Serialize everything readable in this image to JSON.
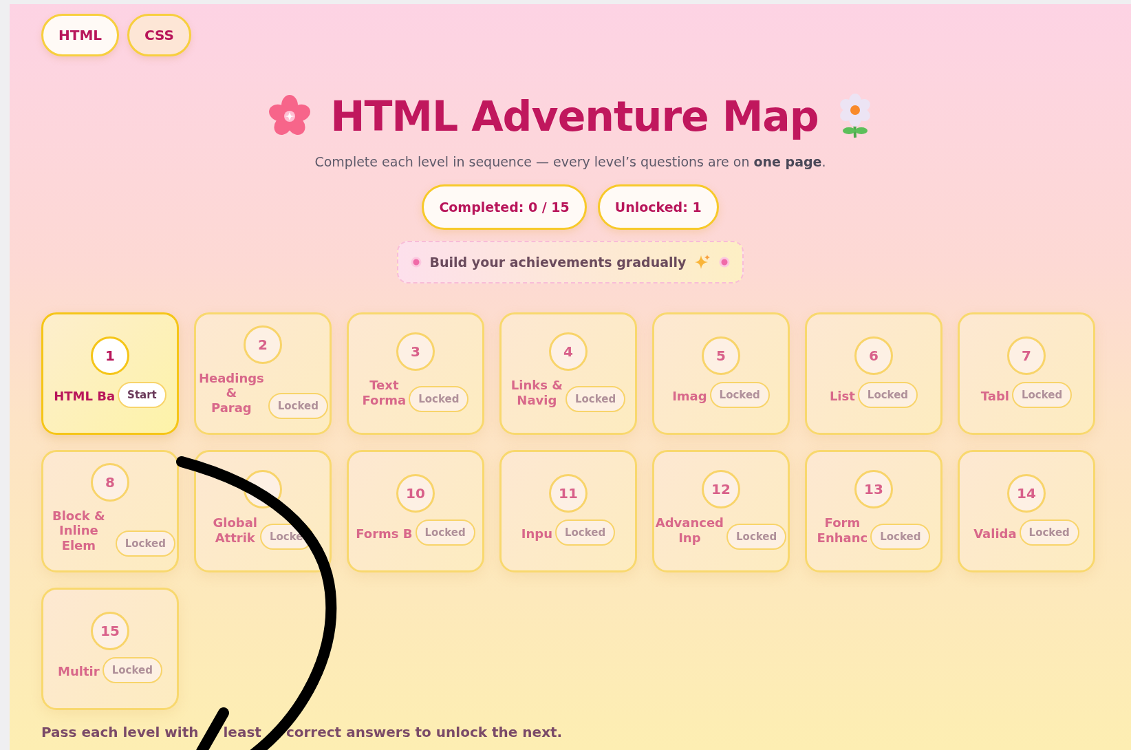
{
  "tabs": [
    {
      "label": "HTML",
      "selected": true
    },
    {
      "label": "CSS",
      "selected": false
    }
  ],
  "header": {
    "title": "HTML Adventure Map",
    "subtitle": "Complete each level in sequence — every level’s questions are on **one page**."
  },
  "stats": [
    "Completed: 0 / 15",
    "Unlocked: 1"
  ],
  "banner": "Build your achievements gradually",
  "levels": [
    {
      "number": "1",
      "title": "HTML Ba",
      "badge": "Start",
      "locked": false
    },
    {
      "number": "2",
      "title": "Headings &\nParag",
      "badge": "Locked",
      "locked": true
    },
    {
      "number": "3",
      "title": "Text\nForma",
      "badge": "Locked",
      "locked": true
    },
    {
      "number": "4",
      "title": "Links &\nNavig",
      "badge": "Locked",
      "locked": true
    },
    {
      "number": "5",
      "title": "Imag",
      "badge": "Locked",
      "locked": true
    },
    {
      "number": "6",
      "title": "List",
      "badge": "Locked",
      "locked": true
    },
    {
      "number": "7",
      "title": "Tabl",
      "badge": "Locked",
      "locked": true
    },
    {
      "number": "8",
      "title": "Block & Inline\nElem",
      "badge": "Locked",
      "locked": true
    },
    {
      "title": "Global\nAttrik",
      "badge": "Locke",
      "locked": true
    },
    {
      "number": "10",
      "title": "Forms B",
      "badge": "Locked",
      "locked": true
    },
    {
      "number": "11",
      "title": "Inpu",
      "badge": "Locked",
      "locked": true
    },
    {
      "number": "12",
      "title": "Advanced\nInp",
      "badge": "Locked",
      "locked": true
    },
    {
      "number": "13",
      "title": "Form\nEnhanc",
      "badge": "Locked",
      "locked": true
    },
    {
      "number": "14",
      "title": "Valida",
      "badge": "Locked",
      "locked": true
    },
    {
      "number": "15",
      "title": "Multir",
      "badge": "Locked",
      "locked": true
    }
  ],
  "footer": [
    "Pass each level with",
    "least",
    "correct answers to unlock the next."
  ]
}
